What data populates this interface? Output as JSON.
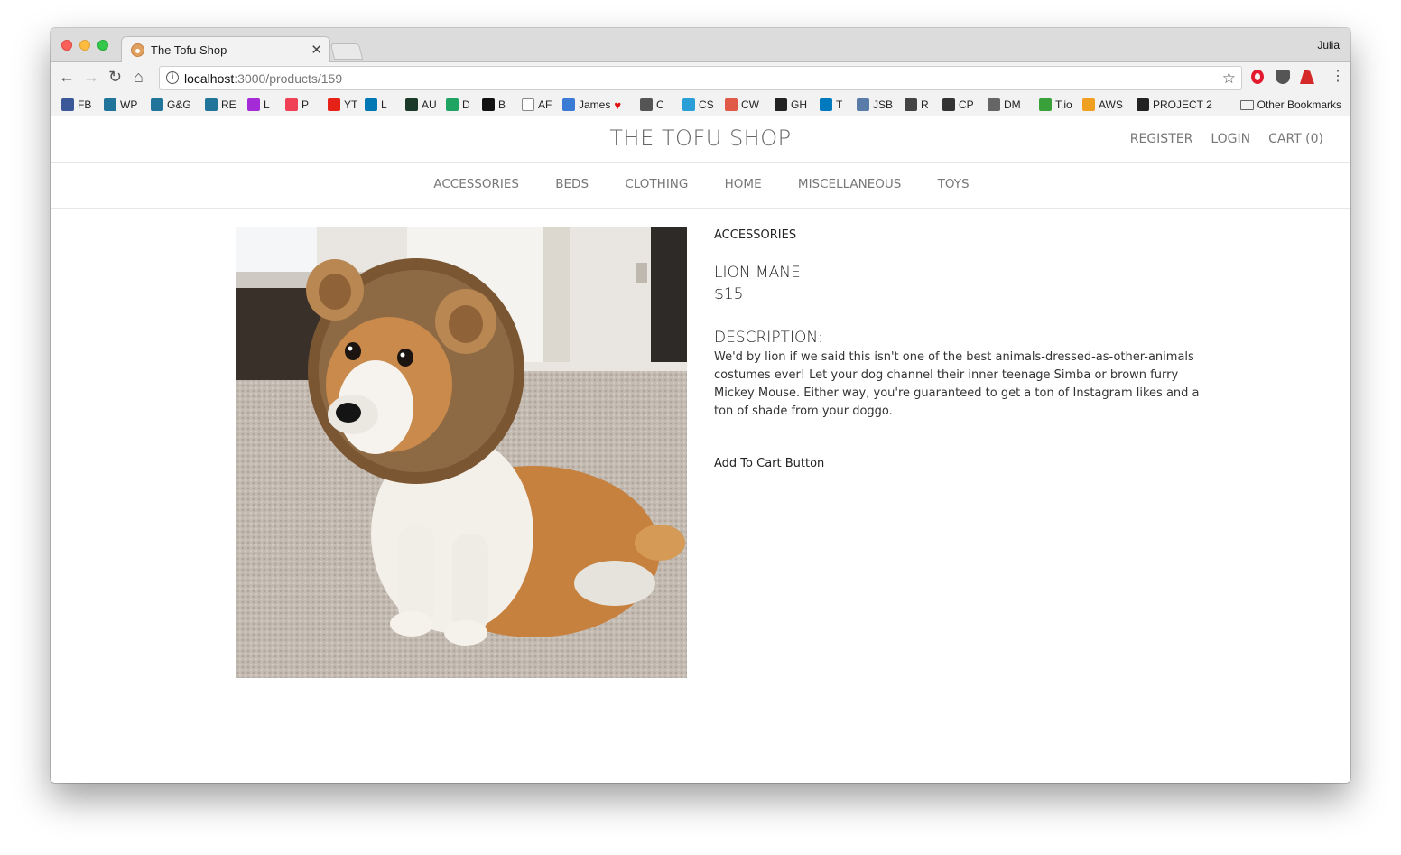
{
  "browser": {
    "tab_title": "The Tofu Shop",
    "profile": "Julia",
    "url_host": "localhost",
    "url_path": ":3000/products/159",
    "bookmarks": [
      {
        "label": "FB",
        "color": "#3b5998"
      },
      {
        "label": "WP",
        "color": "#21759b"
      },
      {
        "label": "G&G",
        "color": "#21759b"
      },
      {
        "label": "RE",
        "color": "#21759b"
      },
      {
        "label": "L",
        "color": "#a52bd6"
      },
      {
        "label": "P",
        "color": "#ef4056"
      },
      {
        "label": "YT",
        "color": "#e62117"
      },
      {
        "label": "L",
        "color": "#0077b5"
      },
      {
        "label": "AU",
        "color": "#1c3a2a"
      },
      {
        "label": "D",
        "color": "#1fa463"
      },
      {
        "label": "B",
        "color": "#111111"
      },
      {
        "label": "AF",
        "color": "#ffffff"
      },
      {
        "label": "James",
        "color": "#3a7bd5"
      },
      {
        "label": "C",
        "color": "#555555"
      },
      {
        "label": "CS",
        "color": "#2a9fd6"
      },
      {
        "label": "CW",
        "color": "#e05a47"
      },
      {
        "label": "GH",
        "color": "#222222"
      },
      {
        "label": "T",
        "color": "#0079bf"
      },
      {
        "label": "JSB",
        "color": "#5a7ca8"
      },
      {
        "label": "R",
        "color": "#444444"
      },
      {
        "label": "CP",
        "color": "#333333"
      },
      {
        "label": "DM",
        "color": "#666666"
      },
      {
        "label": "T.io",
        "color": "#3aa03a"
      },
      {
        "label": "AWS",
        "color": "#f0a020"
      },
      {
        "label": "PROJECT 2",
        "color": "#222222"
      }
    ],
    "other_bookmarks": "Other Bookmarks"
  },
  "site": {
    "title": "THE TOFU SHOP",
    "links": [
      "REGISTER",
      "LOGIN",
      "CART (0)"
    ],
    "categories": [
      "ACCESSORIES",
      "BEDS",
      "CLOTHING",
      "HOME",
      "MISCELLANEOUS",
      "TOYS"
    ]
  },
  "product": {
    "category": "ACCESSORIES",
    "name": "LION MANE",
    "price": "$15",
    "description_heading": "DESCRIPTION:",
    "description": "We'd by lion if we said this isn't one of the best animals-dressed-as-other-animals costumes ever! Let your dog channel their inner teenage Simba or brown furry Mickey Mouse. Either way, you're guaranteed to get a ton of Instagram likes and a ton of shade from your doggo.",
    "cart_button": "Add To Cart Button"
  }
}
